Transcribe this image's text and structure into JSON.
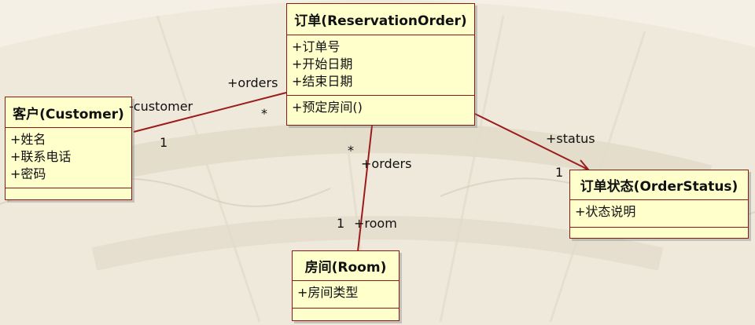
{
  "classes": {
    "order": {
      "name": "订单(ReservationOrder)",
      "attributes": [
        "+订单号",
        "+开始日期",
        "+结束日期"
      ],
      "operations": [
        "+预定房间()"
      ]
    },
    "customer": {
      "name": "客户(Customer)",
      "attributes": [
        "+姓名",
        "+联系电话",
        "+密码"
      ],
      "operations": []
    },
    "room": {
      "name": "房间(Room)",
      "attributes": [
        "+房间类型"
      ],
      "operations": []
    },
    "status": {
      "name": "订单状态(OrderStatus)",
      "attributes": [
        "+状态说明"
      ],
      "operations": []
    }
  },
  "associations": {
    "customer_order": {
      "customer_role": "-customer",
      "customer_mult": "1",
      "order_role": "+orders",
      "order_mult": "*"
    },
    "order_room": {
      "order_mult": "*",
      "order_role": "+orders",
      "room_mult": "1",
      "room_role": "+room"
    },
    "order_status": {
      "status_role": "+status",
      "status_mult": "1"
    }
  },
  "colors": {
    "line": "#9b1c1c",
    "box_fill": "#ffffcc",
    "box_border": "#8b1a1a"
  }
}
